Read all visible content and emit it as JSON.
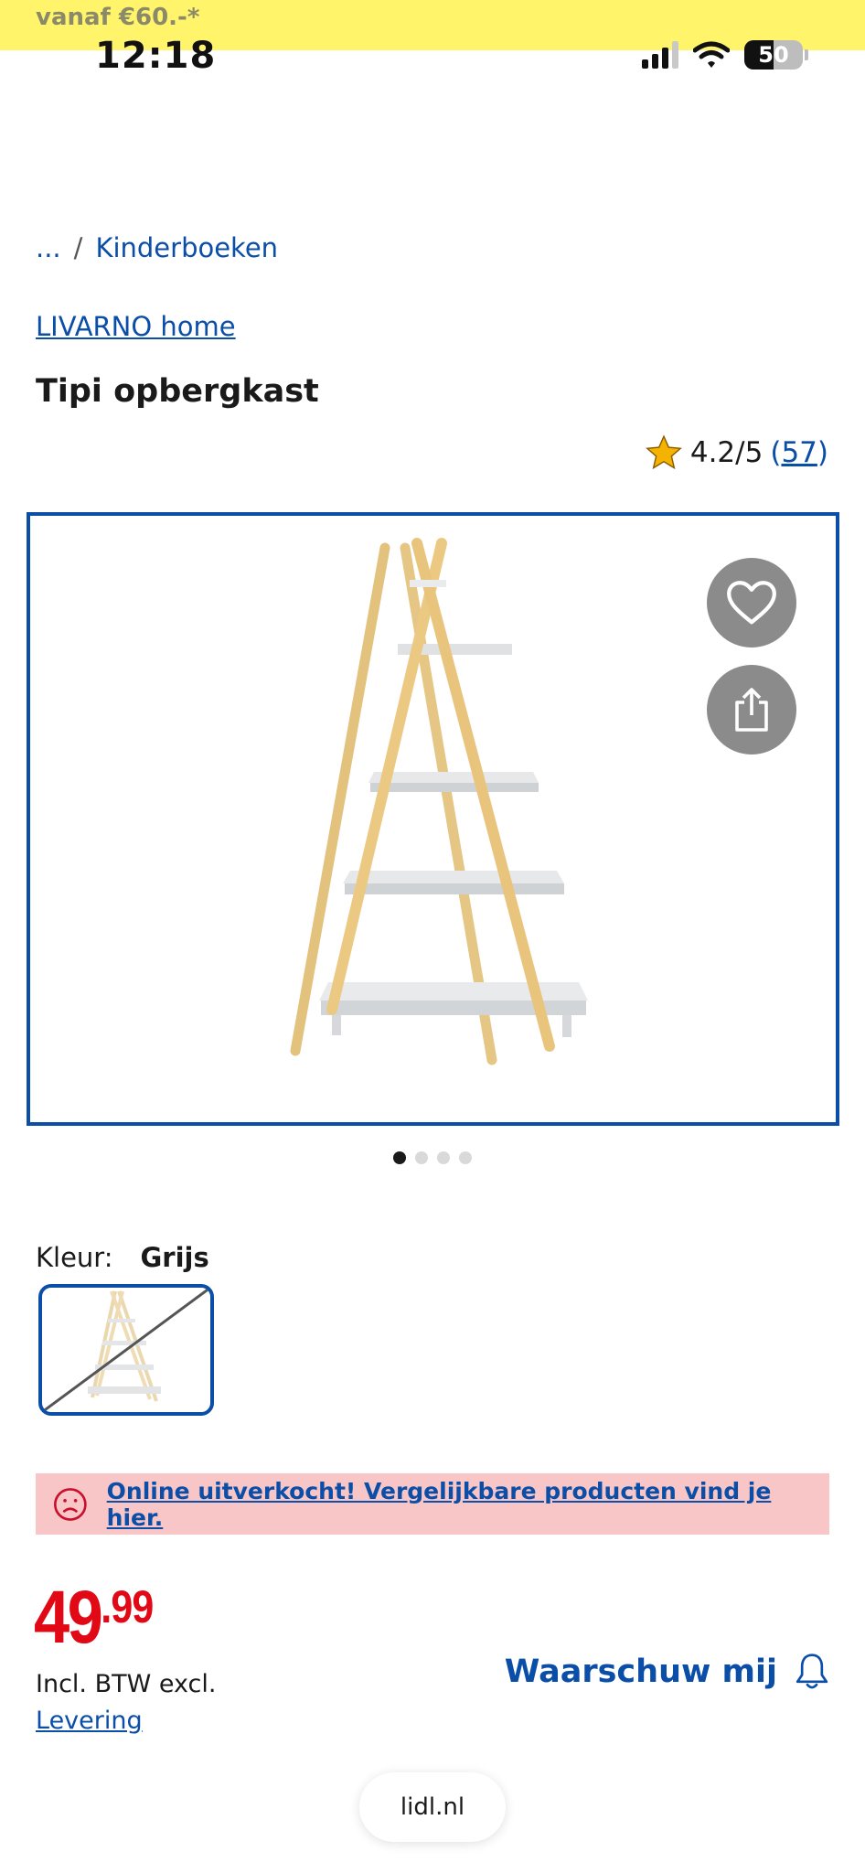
{
  "promo": {
    "text": "vanaf €60.-*"
  },
  "status_bar": {
    "time": "12:18",
    "battery": "50",
    "signal_icon": "cellular-signal-icon",
    "wifi_icon": "wifi-icon"
  },
  "breadcrumb": {
    "ellipsis": "...",
    "separator": "/",
    "category": "Kinderboeken"
  },
  "product": {
    "brand": "LIVARNO home",
    "title": "Tipi opbergkast",
    "rating_value": "4.2/5",
    "rating_count_open": "(",
    "rating_count": "57",
    "rating_count_close": ")",
    "image_count": 4,
    "active_image": 1
  },
  "gallery": {
    "favorite_icon": "heart-icon",
    "share_icon": "share-icon"
  },
  "variant": {
    "label": "Kleur:",
    "value": "Grijs",
    "swatch_unavailable": true
  },
  "alert": {
    "icon": "sad-face-icon",
    "text": "Online uitverkocht! Vergelijkbare producten vind je hier."
  },
  "price": {
    "integer": "49",
    "decimal": ".99",
    "tax_text": "Incl. BTW excl.",
    "delivery_link": "Levering"
  },
  "notify": {
    "label": "Waarschuw mij",
    "icon": "bell-icon"
  },
  "browser": {
    "url": "lidl.nl"
  },
  "colors": {
    "link_blue": "#0b4ea8",
    "price_red": "#e10915",
    "promo_yellow": "#fff46a",
    "alert_pink": "#f8c6c6",
    "icon_button_gray": "#8b8b8b"
  }
}
